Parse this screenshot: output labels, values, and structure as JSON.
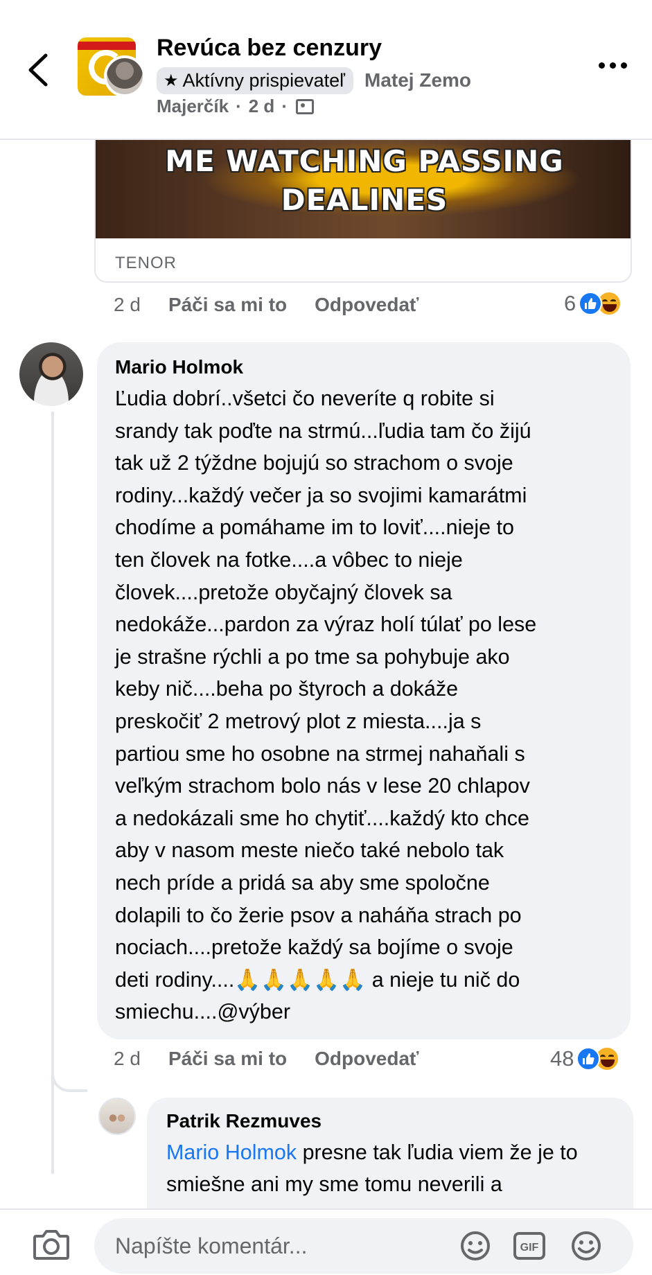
{
  "header": {
    "group_name": "Revúca bez cenzury",
    "badge_label": "Aktívny prispievateľ",
    "author_first": "Matej Zemo",
    "author_last": "Majerčík",
    "time": "2 d",
    "sep": "·"
  },
  "gif": {
    "caption_line1": "ME WATCHING PASSING",
    "caption_line2": "DEALINES",
    "source": "TENOR",
    "time": "2 d",
    "like_label": "Páči sa mi to",
    "reply_label": "Odpovedať",
    "reaction_count": "6",
    "reaction_icons": [
      "like-icon",
      "haha-icon"
    ]
  },
  "comment": {
    "author": "Mario Holmok",
    "text": "Ľudia dobrí..všetci čo neveríte q robite si\nsrandy tak poďte na strmú...ľudia tam čo žijú\ntak už 2 týždne bojujú so strachom o svoje\nrodiny...každý večer ja so svojimi kamarátmi\nchodíme a pomáhame im to loviť....nieje to\nten človek na fotke....a vôbec to nieje\nčlovek....pretože obyčajný človek sa\nnedokáže...pardon za výraz holí túlať po lese\nje strašne rýchli a po tme sa pohybuje ako\nkeby nič....beha po štyroch a dokáže\npreskočiť 2 metrový plot z miesta....ja s\npartiou sme ho osobne na strmej nahaňali s\nveľkým strachom bolo nás v lese 20 chlapov\na nedokázali sme ho chytiť....každý kto chce\naby v nasom meste niečo také nebolo tak\nnech príde a pridá sa aby sme spoločne\ndolapili to čo žerie psov a naháňa strach po\nnociach....pretože každý sa bojíme o svoje\ndeti rodiny....🙏🙏🙏🙏🙏 a nieje tu nič do\nsmiechu....@výber",
    "time": "2 d",
    "like_label": "Páči sa mi to",
    "reply_label": "Odpovedať",
    "reaction_count": "48"
  },
  "reply": {
    "author": "Patrik Rezmuves",
    "mention": "Mario Holmok",
    "text_after_mention": " presne tak ľudia viem že je to smiešne ani my sme tomu neverili a"
  },
  "composer": {
    "placeholder": "Napíšte komentár..."
  },
  "colors": {
    "accent": "#1877f2",
    "bubble": "#f0f2f5",
    "secondary_text": "#65676b"
  }
}
